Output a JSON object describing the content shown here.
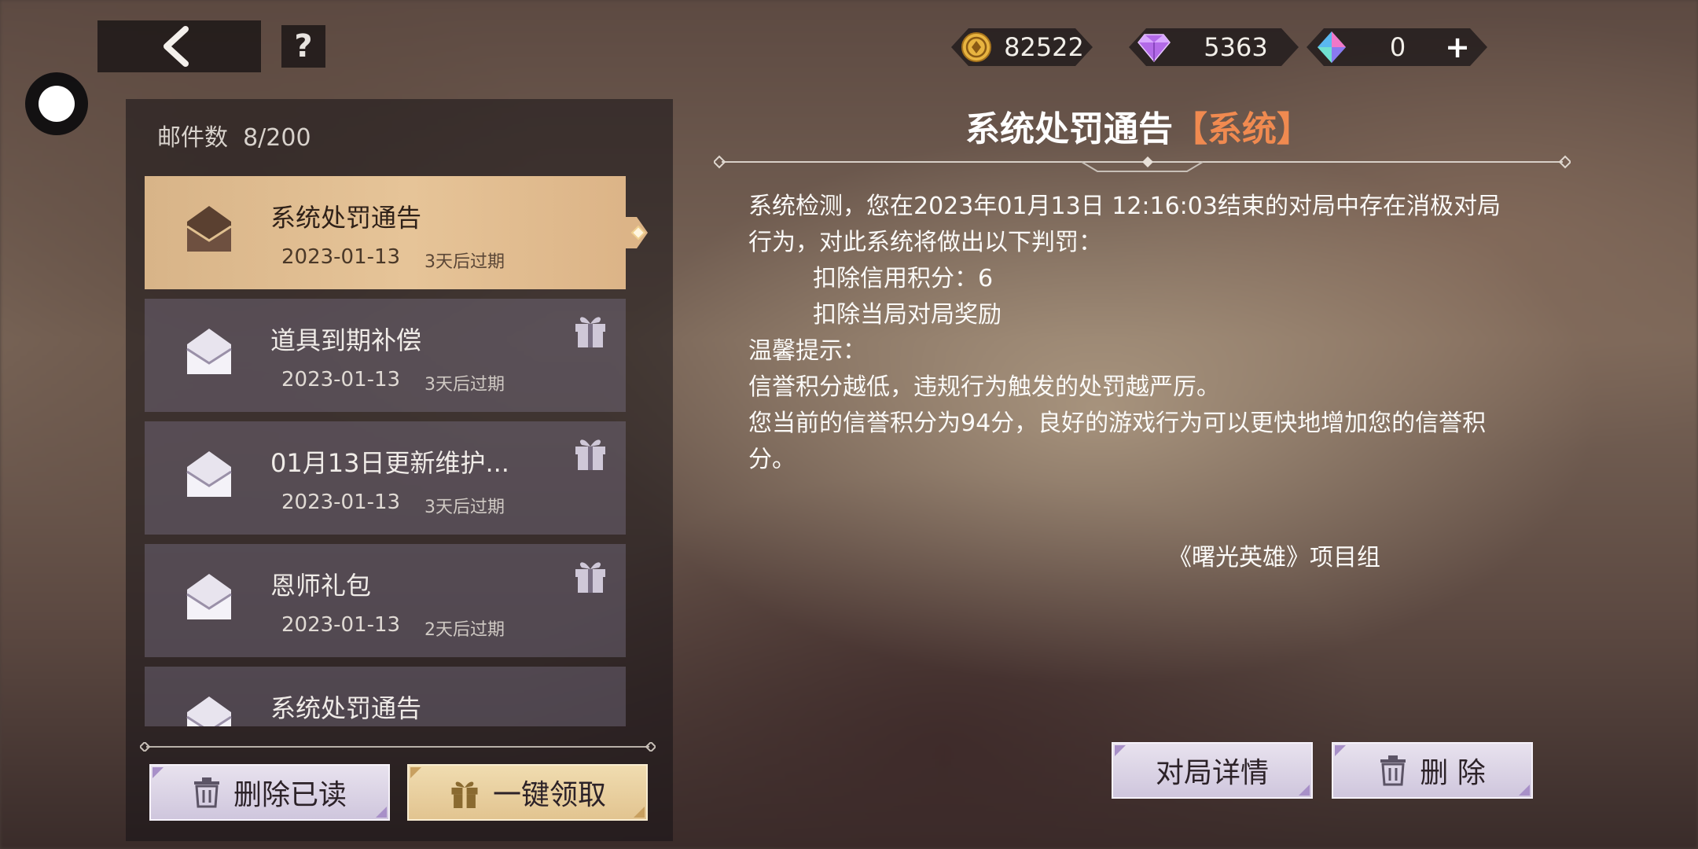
{
  "header": {
    "help_label": "?",
    "currencies": [
      {
        "icon": "gold-coin-icon",
        "value": "82522"
      },
      {
        "icon": "purple-diamond-icon",
        "value": "5363"
      },
      {
        "icon": "crystal-icon",
        "value": "0",
        "add_label": "+"
      }
    ]
  },
  "mailbox": {
    "count_label": "邮件数",
    "count_value": "8/200",
    "items": [
      {
        "title": "系统处罚通告",
        "date": "2023-01-13",
        "expire": "3天后过期",
        "has_gift": false,
        "selected": true
      },
      {
        "title": "道具到期补偿",
        "date": "2023-01-13",
        "expire": "3天后过期",
        "has_gift": true,
        "selected": false
      },
      {
        "title": "01月13日更新维护...",
        "date": "2023-01-13",
        "expire": "3天后过期",
        "has_gift": true,
        "selected": false
      },
      {
        "title": "恩师礼包",
        "date": "2023-01-13",
        "expire": "2天后过期",
        "has_gift": true,
        "selected": false
      },
      {
        "title": "系统处罚通告",
        "date": "",
        "expire": "",
        "has_gift": false,
        "selected": false
      }
    ],
    "delete_read_label": "删除已读",
    "claim_all_label": "一键领取"
  },
  "detail": {
    "title": "系统处罚通告",
    "tag": "【系统】",
    "body": {
      "line1": "系统检测，您在2023年01月13日 12:16:03结束的对局中存在消极对局",
      "line2": "行为，对此系统将做出以下判罚：",
      "penalty1": "扣除信用积分：6",
      "penalty2": "扣除当局对局奖励",
      "tip_label": "温馨提示：",
      "tip1": "信誉积分越低，违规行为触发的处罚越严厉。",
      "tip2": "您当前的信誉积分为94分，良好的游戏行为可以更快地增加您的信誉积",
      "tip3": "分。"
    },
    "signature": "《曙光英雄》项目组",
    "match_detail_label": "对局详情",
    "delete_label": "删 除"
  },
  "colors": {
    "selected_item": "#e0bd90",
    "tag_orange": "#f08a50",
    "item_bg": "#786e82"
  }
}
